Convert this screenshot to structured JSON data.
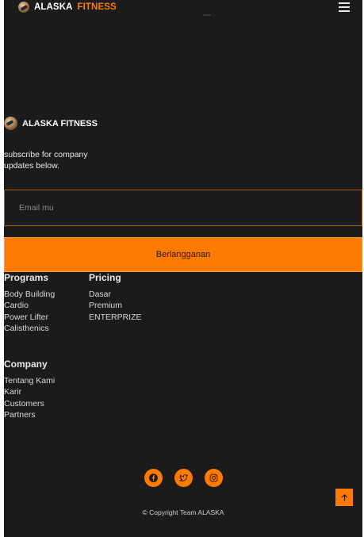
{
  "header": {
    "brand_word1": "ALASKA",
    "brand_word2": "FITNESS",
    "menu_icon": "hamburger-icon"
  },
  "footer": {
    "brand": "ALASKA FITNESS",
    "subscribe_text": "subscribe for company updates below.",
    "email_placeholder": "Email mu",
    "email_value": "",
    "subscribe_button": "Berlangganan",
    "columns": {
      "programs": {
        "title": "Programs",
        "links": [
          "Body Building",
          "Cardio",
          "Power Lifter",
          "Calisthenics"
        ]
      },
      "pricing": {
        "title": "Pricing",
        "links": [
          "Dasar",
          "Premium",
          "ENTERPRIZE"
        ]
      },
      "company": {
        "title": "Company",
        "links": [
          "Tentang Kami",
          "Karir",
          "Customers",
          "Partners"
        ]
      }
    },
    "socials": [
      "facebook-icon",
      "twitter-icon",
      "instagram-icon"
    ],
    "copyright": "© Copyright Team ALASKA",
    "back_to_top_icon": "arrow-up-icon"
  },
  "colors": {
    "background": "#1b1b1b",
    "accent": "#ff7a00",
    "text": "#ffffff"
  }
}
